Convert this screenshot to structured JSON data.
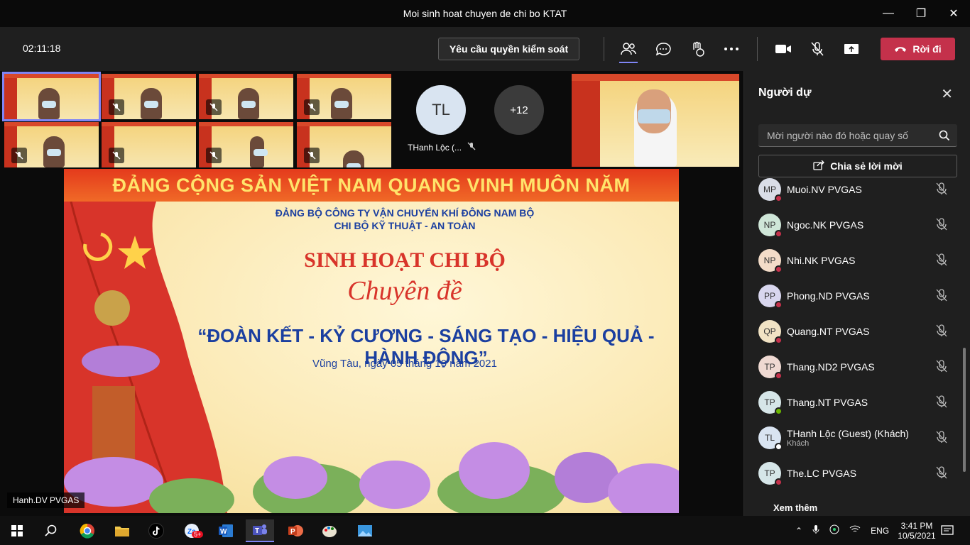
{
  "window": {
    "title": "Moi sinh hoat chuyen de chi bo KTAT"
  },
  "toolbar": {
    "timer": "02:11:18",
    "request_control": "Yêu cầu quyền kiểm soát",
    "leave": "Rời đi"
  },
  "stage": {
    "tile_user": {
      "initials": "TL",
      "name": "THanh Lộc (..."
    },
    "overflow": "+12",
    "speaker_name": "Hanh.DV PVGAS"
  },
  "slide": {
    "banner": "ĐẢNG CỘNG SẢN VIỆT NAM QUANG VINH MUÔN NĂM",
    "org_line1": "ĐẢNG BỘ CÔNG TY VẬN CHUYỂN KHÍ ĐÔNG NAM BỘ",
    "org_line2": "CHI BỘ KỸ THUẬT - AN TOÀN",
    "heading": "SINH HOẠT CHI BỘ",
    "subheading": "Chuyên đề",
    "theme": "“ĐOÀN KẾT - KỶ CƯƠNG - SÁNG TẠO - HIỆU QUẢ - HÀNH ĐỘNG”",
    "date": "Vũng Tàu, ngày 05 tháng 10 năm 2021"
  },
  "panel": {
    "title": "Người dự",
    "search_placeholder": "Mời người nào đó hoặc quay số",
    "share_invite": "Chia sẻ lời mời",
    "see_more": "Xem thêm",
    "participants": [
      {
        "initials": "MP",
        "name": "Muoi.NV PVGAS",
        "sub": "",
        "status": "#c4314b",
        "avatar": "#d9dde7"
      },
      {
        "initials": "NP",
        "name": "Ngoc.NK PVGAS",
        "sub": "",
        "status": "#c4314b",
        "avatar": "#cfe6d8"
      },
      {
        "initials": "NP",
        "name": "Nhi.NK PVGAS",
        "sub": "",
        "status": "#c4314b",
        "avatar": "#f3dcc8"
      },
      {
        "initials": "PP",
        "name": "Phong.ND PVGAS",
        "sub": "",
        "status": "#c4314b",
        "avatar": "#d8d6ee"
      },
      {
        "initials": "QP",
        "name": "Quang.NT PVGAS",
        "sub": "",
        "status": "#c4314b",
        "avatar": "#f1e3c4"
      },
      {
        "initials": "TP",
        "name": "Thang.ND2 PVGAS",
        "sub": "",
        "status": "#c4314b",
        "avatar": "#efd9d2"
      },
      {
        "initials": "TP",
        "name": "Thang.NT PVGAS",
        "sub": "",
        "status": "#6bb700",
        "avatar": "#d6e6e8"
      },
      {
        "initials": "TL",
        "name": "THanh Lộc (Guest) (Khách)",
        "sub": "Khách",
        "status": "#ffffff",
        "avatar": "#d9e4f1"
      },
      {
        "initials": "TP",
        "name": "The.LC PVGAS",
        "sub": "",
        "status": "#c4314b",
        "avatar": "#d6e6e8"
      }
    ]
  },
  "taskbar": {
    "time": "3:41 PM",
    "date": "10/5/2021",
    "lang": "ENG",
    "badge": "5+"
  },
  "colors": {
    "accent": "#7f85f5",
    "leave": "#c4314b",
    "panel_bg": "#1f1f1f"
  }
}
